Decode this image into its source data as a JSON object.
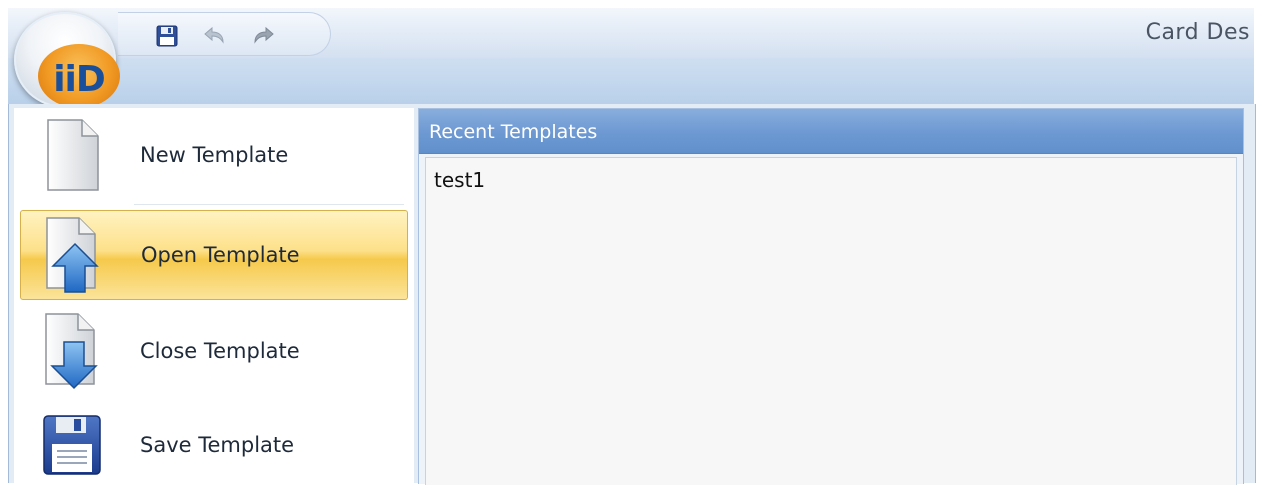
{
  "window": {
    "title": "Card Des"
  },
  "app_button": {
    "logo_text": "iiD",
    "logo_icon": "iid-logo-icon"
  },
  "quick_access_toolbar": {
    "items": [
      {
        "name": "save",
        "icon": "floppy-disk-icon"
      },
      {
        "name": "undo",
        "icon": "undo-arrow-icon",
        "disabled": true
      },
      {
        "name": "redo",
        "icon": "redo-arrow-icon",
        "disabled": true
      }
    ]
  },
  "menu": {
    "items": [
      {
        "label": "New Template",
        "icon": "new-document-icon",
        "active": false
      },
      {
        "label": "Open Template",
        "icon": "open-document-icon",
        "active": true
      },
      {
        "label": "Close Template",
        "icon": "close-document-icon",
        "active": false
      },
      {
        "label": "Save Template",
        "icon": "floppy-disk-icon",
        "active": false
      }
    ]
  },
  "recent": {
    "header": "Recent Templates",
    "items": [
      "test1"
    ]
  },
  "colors": {
    "accent": "#6f9ad3",
    "active_item": "#f6c94b",
    "logo_orange": "#f19a24",
    "logo_blue": "#1a4f9c"
  }
}
